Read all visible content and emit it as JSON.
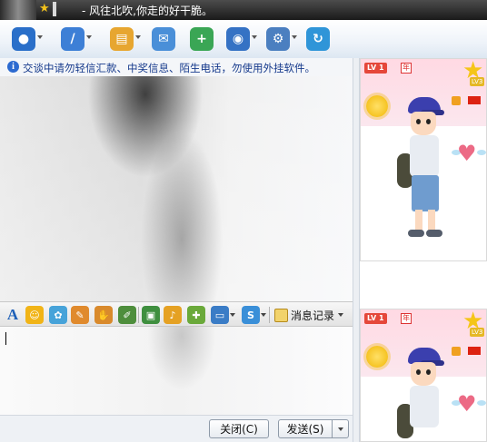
{
  "window": {
    "title": "- 风往北吹,你走的好干脆。"
  },
  "toolbar": {
    "buttons": [
      {
        "name": "video-chat-icon",
        "color": "#2a6fc9",
        "glyph": "●",
        "has_dropdown": true
      },
      {
        "name": "voice-chat-icon",
        "color": "#3d7fd6",
        "glyph": "/",
        "has_dropdown": true
      },
      {
        "name": "send-file-icon",
        "color": "#e7a630",
        "glyph": "▤",
        "has_dropdown": true
      },
      {
        "name": "send-message-icon",
        "color": "#4a8fd8",
        "glyph": "✉",
        "has_dropdown": false
      },
      {
        "name": "create-group-icon",
        "color": "#3aa655",
        "glyph": "+",
        "has_dropdown": false
      },
      {
        "name": "remote-assistance-icon",
        "color": "#3572c4",
        "glyph": "◉",
        "has_dropdown": true
      },
      {
        "name": "app-settings-icon",
        "color": "#4b7fc0",
        "glyph": "⚙",
        "has_dropdown": true
      },
      {
        "name": "transfer-icon",
        "color": "#2f95d8",
        "glyph": "↻",
        "has_dropdown": false
      }
    ]
  },
  "notice": {
    "icon": "info-icon",
    "text": "交谈中请勿轻信汇款、中奖信息、陌生电话，勿使用外挂软件。"
  },
  "format_toolbar": {
    "items": [
      {
        "name": "font-icon",
        "glyph": "A",
        "color": "#1c5fb8"
      },
      {
        "name": "emoticon-icon",
        "glyph": "☺",
        "color": "#f1b417"
      },
      {
        "name": "magic-emoticon-icon",
        "glyph": "✿",
        "color": "#47a3d9"
      },
      {
        "name": "doodle-icon",
        "glyph": "✎",
        "color": "#e08a2d"
      },
      {
        "name": "shake-window-icon",
        "glyph": "✋",
        "color": "#d98a2c"
      },
      {
        "name": "edit-icon",
        "glyph": "✐",
        "color": "#4e8e3c"
      },
      {
        "name": "image-icon",
        "glyph": "▣",
        "color": "#3f8f3f"
      },
      {
        "name": "music-icon",
        "glyph": "♪",
        "color": "#e5a123"
      },
      {
        "name": "gift-icon",
        "glyph": "✚",
        "color": "#6aa93a"
      },
      {
        "name": "screenshot-icon",
        "glyph": "▭",
        "color": "#3a7cc6"
      },
      {
        "name": "soso-icon",
        "glyph": "S",
        "color": "#3a8fd8"
      }
    ],
    "message_history": {
      "label": "消息记录",
      "icon": "message-history-icon"
    }
  },
  "input": {
    "value": ""
  },
  "buttons": {
    "close_label": "关闭(C)",
    "send_label": "发送(S)"
  },
  "profile": {
    "level_badge": "LV 1",
    "year_badge": "年",
    "star_level": "LV3"
  }
}
